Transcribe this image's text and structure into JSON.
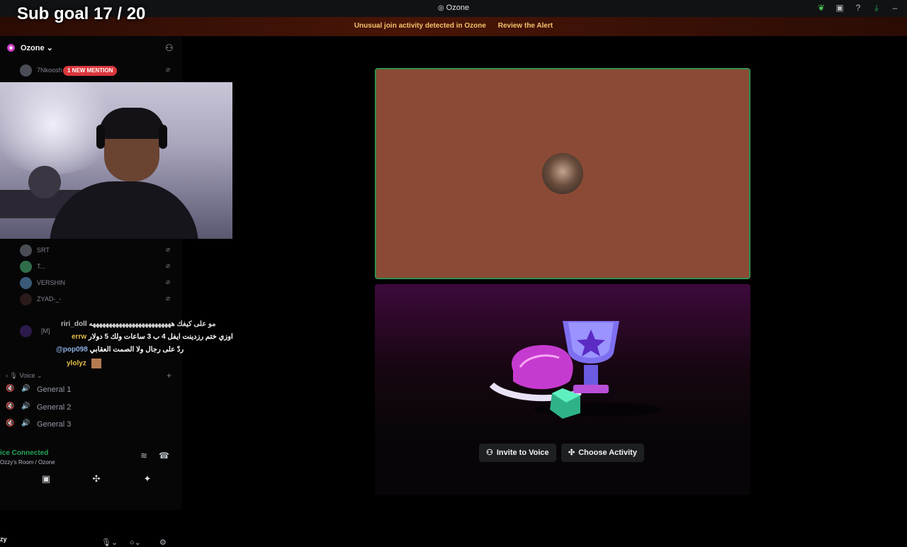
{
  "overlay": {
    "sub_goal": "Sub goal 17 / 20"
  },
  "window": {
    "title": "Ozone"
  },
  "alert": {
    "text": "Unusual join activity detected in Ozone",
    "action": "Review the Alert"
  },
  "server": {
    "name": "Ozone"
  },
  "members": [
    {
      "name": "7Nkoosh"
    },
    {
      "name": "SRT"
    },
    {
      "name": "T..."
    },
    {
      "name": "VERSHIN"
    },
    {
      "name": "ZYAD-_-"
    },
    {
      "name": "[M]"
    }
  ],
  "mention_badge": "1 NEW MENTION",
  "chat": [
    {
      "user": "riri_doll",
      "msg": "مو على كيفك هههههههههههههههههههههههههه"
    },
    {
      "user": "errw",
      "msg": "اوزي ختم رزدينت ايفل 4 ب 3 ساعات ولك 5 دولار"
    },
    {
      "user": "@pop098",
      "msg": "ردّ على رجال ولا الصمت العقابي"
    },
    {
      "user": "ylolyz",
      "msg": ""
    }
  ],
  "voice": {
    "header": "Voice",
    "channels": [
      "General 1",
      "General 2",
      "General 3"
    ]
  },
  "voice_status": {
    "label": "ice Connected",
    "location": "Ozzy's Room / Ozone"
  },
  "user": {
    "name": "zy"
  },
  "stage": {
    "invite_label": "Invite to Voice",
    "activity_label": "Choose Activity"
  }
}
